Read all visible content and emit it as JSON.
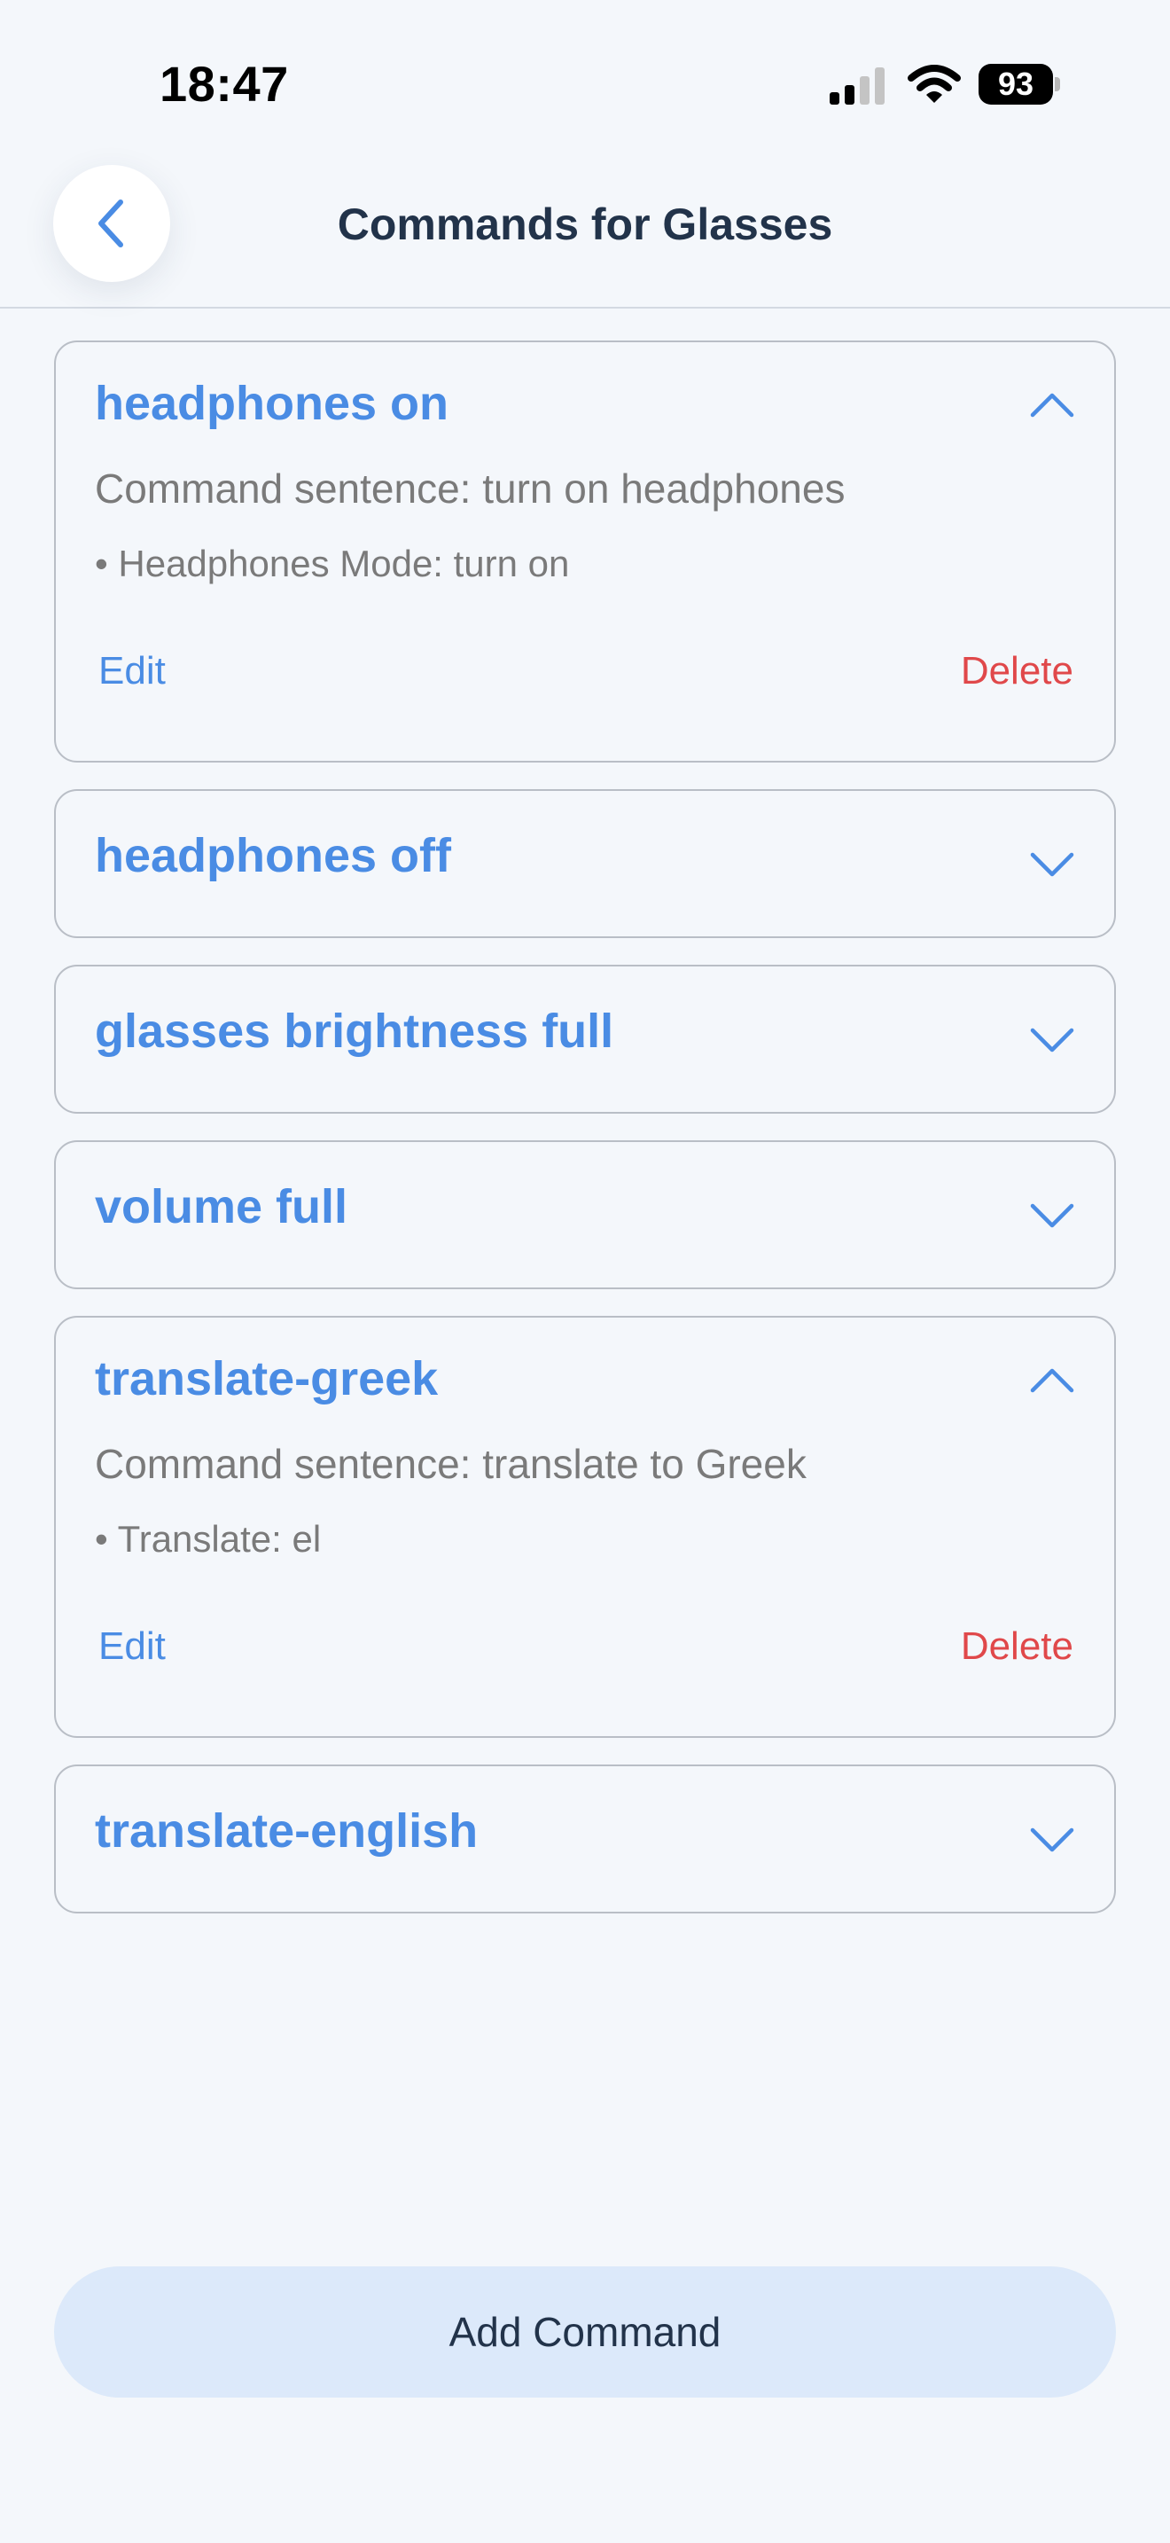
{
  "status_bar": {
    "time": "18:47",
    "battery": "93",
    "icons": [
      "signal-icon",
      "wifi-icon",
      "battery-icon"
    ]
  },
  "header": {
    "title": "Commands for Glasses",
    "back_icon": "chevron-left-icon"
  },
  "commands": [
    {
      "title": "headphones on",
      "expanded": true,
      "sentence": "Command sentence: turn on headphones",
      "action": "• Headphones Mode: turn on",
      "edit_label": "Edit",
      "delete_label": "Delete"
    },
    {
      "title": "headphones off",
      "expanded": false
    },
    {
      "title": "glasses brightness full",
      "expanded": false
    },
    {
      "title": "volume full",
      "expanded": false
    },
    {
      "title": "translate-greek",
      "expanded": true,
      "sentence": "Command sentence: translate to Greek",
      "action": "• Translate: el",
      "edit_label": "Edit",
      "delete_label": "Delete"
    },
    {
      "title": "translate-english",
      "expanded": false
    }
  ],
  "add_button_label": "Add Command",
  "colors": {
    "accent": "#4a8ce4",
    "danger": "#e0484a",
    "background": "#f4f7fb",
    "button_bg": "#dce9fa"
  }
}
